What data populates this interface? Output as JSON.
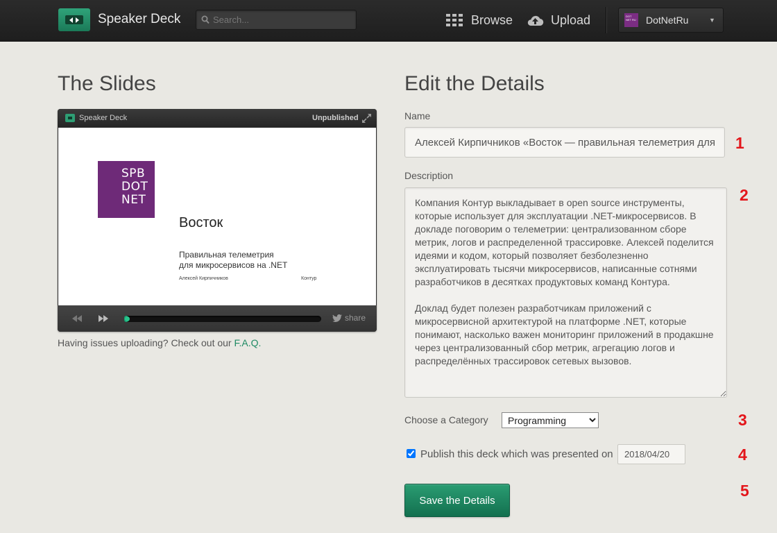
{
  "header": {
    "brand": "Speaker Deck",
    "search_placeholder": "Search...",
    "browse_label": "Browse",
    "upload_label": "Upload",
    "account_name": "DotNetRu",
    "avatar_text": "DOT NET RU"
  },
  "slides": {
    "heading": "The Slides",
    "player_brand": "Speaker Deck",
    "status": "Unpublished",
    "slide": {
      "logo_lines": [
        "SPB",
        "DOT",
        "NET"
      ],
      "title": "Восток",
      "subtitle_line1": "Правильная телеметрия",
      "subtitle_line2": "для микросервисов на .NET",
      "author": "Алексей Кирпичников",
      "company": "Контур"
    },
    "share_label": "share",
    "progress": 0.02,
    "issues_prefix": "Having issues uploading? Check out our ",
    "faq_link": "F.A.Q."
  },
  "details": {
    "heading": "Edit the Details",
    "name_label": "Name",
    "name_value": "Алексей Кирпичников «Восток — правильная телеметрия для микросервисов на .NET»",
    "description_label": "Description",
    "description_value": "Компания Контур выкладывает в open source инструменты, которые использует для эксплуатации .NET-микросервисов. В докладе поговорим о телеметрии: централизованном сборе метрик, логов и распределенной трассировке. Алексей поделится идеями и кодом, который позволяет безболезненно эксплуатировать тысячи микросервисов, написанные сотнями разработчиков в десятках продуктовых команд Контура.\n\nДоклад будет полезен разработчикам приложений с микросервисной архитектурой на платформе .NET, которые понимают, насколько важен мониторинг приложений в продакшне через централизованный сбор метрик, агрегацию логов и распределённых трассировок сетевых вызовов.",
    "category_label": "Choose a Category",
    "category_value": "Programming",
    "publish_label": "Publish this deck which was presented on",
    "publish_checked": true,
    "date_value": "2018/04/20",
    "save_label": "Save the Details"
  },
  "markers": [
    "1",
    "2",
    "3",
    "4",
    "5"
  ],
  "colors": {
    "accent": "#1e8a63",
    "marker": "#e3161b",
    "topbar": "#222222",
    "logo_purple": "#6e2a78"
  }
}
